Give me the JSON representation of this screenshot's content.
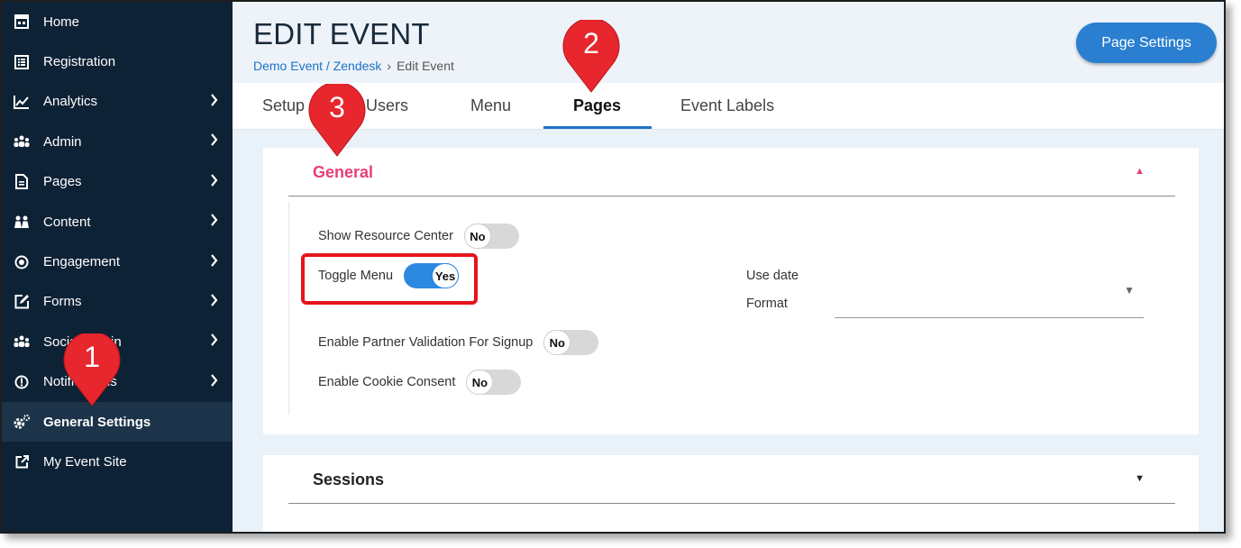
{
  "sidebar": {
    "items": [
      {
        "label": "Home",
        "icon": "home-icon",
        "chevron": false
      },
      {
        "label": "Registration",
        "icon": "registration-icon",
        "chevron": false
      },
      {
        "label": "Analytics",
        "icon": "analytics-icon",
        "chevron": true
      },
      {
        "label": "Admin",
        "icon": "admin-icon",
        "chevron": true
      },
      {
        "label": "Pages",
        "icon": "pages-icon",
        "chevron": true
      },
      {
        "label": "Content",
        "icon": "content-icon",
        "chevron": true
      },
      {
        "label": "Engagement",
        "icon": "engagement-icon",
        "chevron": true
      },
      {
        "label": "Forms",
        "icon": "forms-icon",
        "chevron": true
      },
      {
        "label": "Social Admin",
        "icon": "social-admin-icon",
        "chevron": true
      },
      {
        "label": "Notifications",
        "icon": "notifications-icon",
        "chevron": true
      },
      {
        "label": "General Settings",
        "icon": "gear-icon",
        "chevron": false,
        "active": true
      },
      {
        "label": "My Event Site",
        "icon": "external-link-icon",
        "chevron": false
      }
    ]
  },
  "header": {
    "title": "EDIT EVENT",
    "breadcrumb_link": "Demo Event / Zendesk",
    "breadcrumb_sep": "›",
    "breadcrumb_current": "Edit Event",
    "page_settings_label": "Page Settings"
  },
  "tabs": {
    "items": [
      {
        "label": "Setup"
      },
      {
        "label": "Users"
      },
      {
        "label": "Menu"
      },
      {
        "label": "Pages",
        "active": true
      },
      {
        "label": "Event Labels"
      }
    ]
  },
  "general": {
    "title": "General",
    "caret": "▲",
    "fields": {
      "resource_center": {
        "label": "Show Resource Center",
        "value": "No"
      },
      "toggle_menu": {
        "label": "Toggle Menu",
        "value": "Yes"
      },
      "partner_validation": {
        "label": "Enable Partner Validation For Signup",
        "value": "No"
      },
      "cookie_consent": {
        "label": "Enable Cookie Consent",
        "value": "No"
      }
    },
    "date_label_1": "Use date",
    "date_label_2": "Format",
    "date_caret": "▼"
  },
  "sessions": {
    "title": "Sessions",
    "caret": "▼"
  },
  "callouts": {
    "one": "1",
    "two": "2",
    "three": "3"
  },
  "colors": {
    "sidebar_bg": "#0e2235",
    "accent_blue": "#2a7fd0",
    "pink": "#e83e7a",
    "callout_red": "#e8262d",
    "highlight_red": "#e5141c"
  }
}
